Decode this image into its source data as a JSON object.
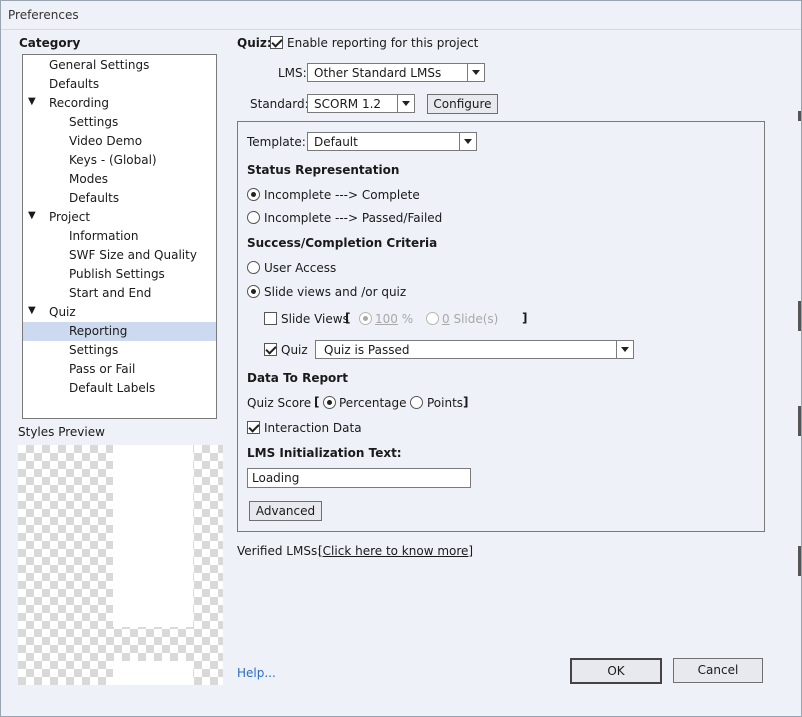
{
  "window": {
    "title": "Preferences"
  },
  "category": {
    "heading": "Category",
    "items": [
      {
        "label": "General Settings",
        "level": 1,
        "expander": "",
        "selected": false
      },
      {
        "label": "Defaults",
        "level": 1,
        "expander": "",
        "selected": false
      },
      {
        "label": "Recording",
        "level": 1,
        "expander": "▼",
        "selected": false
      },
      {
        "label": "Settings",
        "level": 2,
        "expander": "",
        "selected": false
      },
      {
        "label": "Video Demo",
        "level": 2,
        "expander": "",
        "selected": false
      },
      {
        "label": "Keys - (Global)",
        "level": 2,
        "expander": "",
        "selected": false
      },
      {
        "label": "Modes",
        "level": 2,
        "expander": "",
        "selected": false
      },
      {
        "label": "Defaults",
        "level": 2,
        "expander": "",
        "selected": false
      },
      {
        "label": "Project",
        "level": 1,
        "expander": "▼",
        "selected": false
      },
      {
        "label": "Information",
        "level": 2,
        "expander": "",
        "selected": false
      },
      {
        "label": "SWF Size and Quality",
        "level": 2,
        "expander": "",
        "selected": false
      },
      {
        "label": "Publish Settings",
        "level": 2,
        "expander": "",
        "selected": false
      },
      {
        "label": "Start and End",
        "level": 2,
        "expander": "",
        "selected": false
      },
      {
        "label": "Quiz",
        "level": 1,
        "expander": "▼",
        "selected": false
      },
      {
        "label": "Reporting",
        "level": 2,
        "expander": "",
        "selected": true
      },
      {
        "label": "Settings",
        "level": 2,
        "expander": "",
        "selected": false
      },
      {
        "label": "Pass or Fail",
        "level": 2,
        "expander": "",
        "selected": false
      },
      {
        "label": "Default Labels",
        "level": 2,
        "expander": "",
        "selected": false
      }
    ]
  },
  "preview": {
    "label": "Styles Preview"
  },
  "quiz": {
    "label": "Quiz:",
    "enable_reporting": {
      "label": "Enable reporting for this project",
      "checked": true
    }
  },
  "lms": {
    "label": "LMS:",
    "value": "Other Standard LMSs"
  },
  "standard": {
    "label": "Standard:",
    "value": "SCORM 1.2",
    "configure_label": "Configure"
  },
  "template": {
    "label": "Template:",
    "value": "Default"
  },
  "status_representation": {
    "heading": "Status Representation",
    "option_complete": {
      "label": "Incomplete ---> Complete",
      "checked": true
    },
    "option_passed": {
      "label": "Incomplete ---> Passed/Failed",
      "checked": false
    }
  },
  "criteria": {
    "heading": "Success/Completion Criteria",
    "user_access": {
      "label": "User Access",
      "checked": false
    },
    "slide_views_quiz": {
      "label": "Slide views and /or quiz",
      "checked": true
    },
    "slide_views": {
      "label": "Slide Views",
      "checked": false,
      "bracket_open": "[",
      "bracket_close": "]",
      "percent_value": "100",
      "percent_unit": " %",
      "slides_value": "0",
      "slides_unit": " Slide(s)"
    },
    "quiz": {
      "label": "Quiz",
      "checked": true,
      "value": "Quiz is Passed"
    }
  },
  "data_to_report": {
    "heading": "Data To Report",
    "quiz_score_label": "Quiz Score",
    "bracket_open": "[",
    "bracket_close": "]",
    "percentage": {
      "label": "Percentage",
      "checked": true
    },
    "points": {
      "label": "Points",
      "checked": false
    },
    "interaction_data": {
      "label": "Interaction Data",
      "checked": true
    }
  },
  "lms_init": {
    "heading": "LMS Initialization Text:",
    "value": "Loading"
  },
  "advanced_label": "Advanced",
  "verified": {
    "label": "Verified LMSs:",
    "link": "[Click here to know more]"
  },
  "footer": {
    "help": "Help...",
    "ok": "OK",
    "cancel": "Cancel"
  }
}
